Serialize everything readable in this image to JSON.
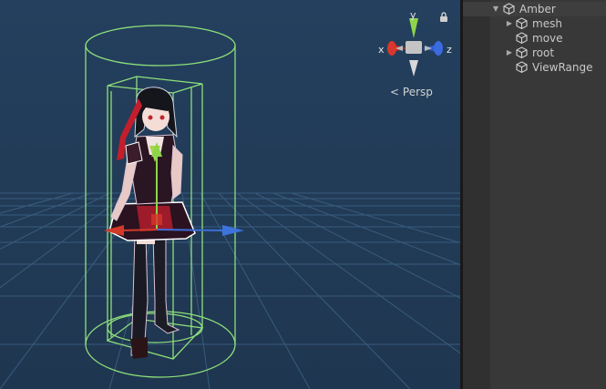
{
  "scene_view": {
    "projection_label": "Persp",
    "gizmo": {
      "x_label": "x",
      "y_label": "y",
      "z_label": "z"
    },
    "colors": {
      "background": "#213750",
      "grid": "#3d6286",
      "collider": "#8ee07a",
      "axis_x": "#d23a2a",
      "axis_y": "#8ed54a",
      "axis_z": "#3c6fd8"
    }
  },
  "hierarchy": {
    "items": [
      {
        "label": "Amber",
        "expanded": true,
        "has_children": true,
        "depth": 0
      },
      {
        "label": "mesh",
        "expanded": false,
        "has_children": true,
        "depth": 1
      },
      {
        "label": "move",
        "expanded": false,
        "has_children": false,
        "depth": 1
      },
      {
        "label": "root",
        "expanded": false,
        "has_children": true,
        "depth": 1
      },
      {
        "label": "ViewRange",
        "expanded": false,
        "has_children": false,
        "depth": 1
      }
    ]
  }
}
